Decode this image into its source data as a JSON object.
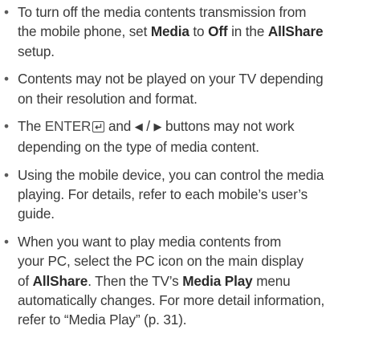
{
  "notes": [
    {
      "lines": [
        [
          {
            "t": "To turn off the media contents transmission from"
          }
        ],
        [
          {
            "t": "the mobile phone, set "
          },
          {
            "t": "Media",
            "b": true
          },
          {
            "t": " to "
          },
          {
            "t": "Off",
            "b": true
          },
          {
            "t": " in the "
          },
          {
            "t": "AllShare",
            "b": true
          }
        ],
        [
          {
            "t": "setup."
          }
        ]
      ]
    },
    {
      "lines": [
        [
          {
            "t": "Contents may not be played on your TV depending"
          }
        ],
        [
          {
            "t": "on their resolution and format."
          }
        ]
      ]
    },
    {
      "lines": [
        [
          {
            "t": "The "
          },
          {
            "t": "ENTER",
            "enter": true
          },
          {
            "t": " and "
          },
          {
            "t": "◀",
            "tri": true
          },
          {
            "t": " / "
          },
          {
            "t": "▶",
            "tri": true
          },
          {
            "t": " buttons may not work"
          }
        ],
        [
          {
            "t": "depending on the type of media content."
          }
        ]
      ]
    },
    {
      "lines": [
        [
          {
            "t": "Using the mobile device, you can control the media"
          }
        ],
        [
          {
            "t": "playing. For details, refer to each mobile’s user’s"
          }
        ],
        [
          {
            "t": "guide."
          }
        ]
      ]
    },
    {
      "lines": [
        [
          {
            "t": "When you want to play media contents from"
          }
        ],
        [
          {
            "t": "your PC, select the PC icon on the main display"
          }
        ],
        [
          {
            "t": "of "
          },
          {
            "t": "AllShare",
            "b": true
          },
          {
            "t": ". Then the TV’s "
          },
          {
            "t": "Media Play",
            "b": true
          },
          {
            "t": " menu"
          }
        ],
        [
          {
            "t": "automatically changes. For more detail information,"
          }
        ],
        [
          {
            "t": "refer to “Media Play” (p. 31)."
          }
        ]
      ]
    }
  ],
  "icons": {
    "bullet": "bullet-dot",
    "enter": "enter-return-icon",
    "left": "left-triangle-icon",
    "right": "right-triangle-icon"
  }
}
